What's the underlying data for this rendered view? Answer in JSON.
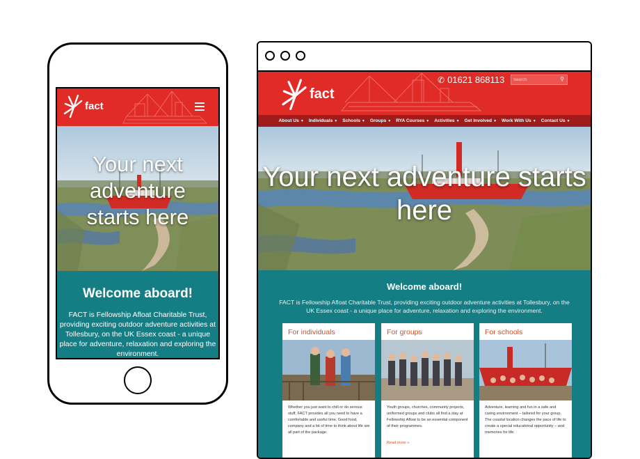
{
  "site": {
    "logo_text": "fact",
    "hero_title": "Your next adventure starts here",
    "welcome_title": "Welcome aboard!",
    "welcome_text": "FACT is Fellowship Afloat Charitable Trust, providing exciting outdoor adventure activities at Tollesbury, on the UK Essex coast - a unique place for adventure, relaxation and exploring the environment."
  },
  "mobile": {
    "hero_lines": [
      "Your next",
      "adventure",
      "starts here"
    ]
  },
  "desktop": {
    "phone": "01621 868113",
    "search_placeholder": "Search",
    "nav": [
      {
        "label": "About Us"
      },
      {
        "label": "Individuals"
      },
      {
        "label": "Schools"
      },
      {
        "label": "Groups"
      },
      {
        "label": "RYA Courses"
      },
      {
        "label": "Activities"
      },
      {
        "label": "Get Involved"
      },
      {
        "label": "Work With Us"
      },
      {
        "label": "Contact Us"
      }
    ],
    "cards": [
      {
        "title": "For individuals",
        "text": "Whether you just want to chill or do serious stuff, FACT provides all you need to have a comfortable and useful time. Good food, company and a bit of time to think about life are all part of the package.",
        "more": ""
      },
      {
        "title": "For groups",
        "text": "Youth groups, churches, community projects, uniformed groups and clubs all find a stay at Fellowship Afloat to be an essential component of their programmes.",
        "more": "Read more »"
      },
      {
        "title": "For schools",
        "text": "Adventure, learning and fun in a safe and caring environment – tailored for your group. The coastal location changes the pace of life to create a special educational opportunity – and memories for life.",
        "more": ""
      }
    ]
  },
  "colors": {
    "brand_red": "#e12b27",
    "nav_red": "#a01b1b",
    "teal": "#157e85",
    "card_title": "#e14a1f"
  },
  "icons": {
    "logo": "starburst-icon",
    "menu": "hamburger-icon",
    "phone": "phone-icon",
    "search": "search-icon",
    "caret": "caret-down-icon"
  }
}
